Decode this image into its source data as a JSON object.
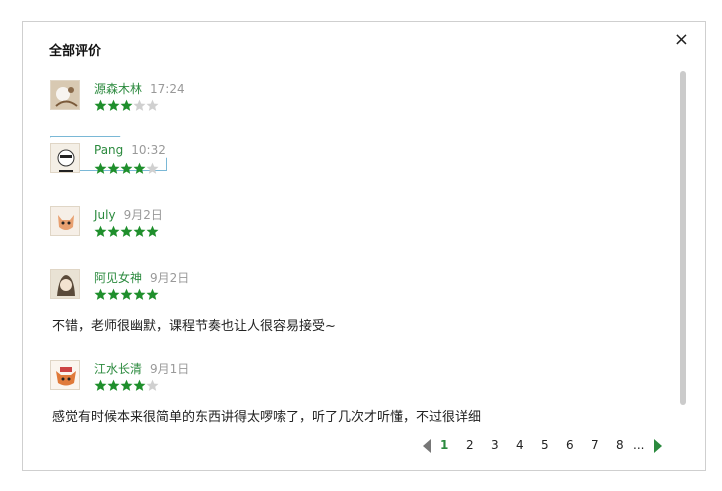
{
  "dialog": {
    "title": "全部评价",
    "close_glyph": "×"
  },
  "reviews": [
    {
      "name": "源森木林",
      "time": "17:24",
      "rating": 3,
      "comment": ""
    },
    {
      "name": "Pang",
      "time": "10:32",
      "rating": 4,
      "comment": ""
    },
    {
      "name": "July",
      "time": "9月2日",
      "rating": 5,
      "comment": ""
    },
    {
      "name": "阿见女神",
      "time": "9月2日",
      "rating": 5,
      "comment": "不错，老师很幽默，课程节奏也让人很容易接受~"
    },
    {
      "name": "江水长清",
      "time": "9月1日",
      "rating": 4,
      "comment": "感觉有时候本来很简单的东西讲得太啰嗦了，听了几次才听懂，不过很详细"
    }
  ],
  "pager": {
    "pages": [
      "1",
      "2",
      "3",
      "4",
      "5",
      "6",
      "7",
      "8"
    ],
    "ellipsis": "...",
    "current": "1"
  },
  "colors": {
    "accent": "#2b8a3e",
    "star_filled": "#1f8f2c",
    "star_empty": "#d0d0d0"
  },
  "icons": {
    "close": "close-icon",
    "prev": "prev-page-icon",
    "next": "next-page-icon",
    "star": "star-icon"
  }
}
